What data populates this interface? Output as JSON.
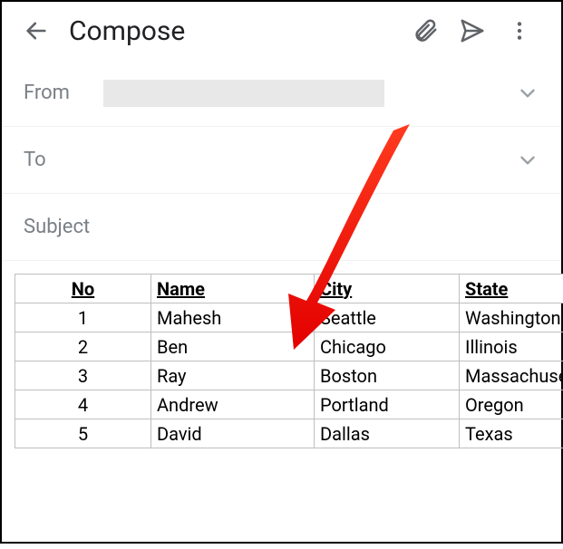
{
  "toolbar": {
    "title": "Compose"
  },
  "fields": {
    "from_label": "From",
    "to_label": "To",
    "subject_label": "Subject"
  },
  "table": {
    "headers": {
      "no": "No",
      "name": "Name",
      "city": "City",
      "state": "State"
    },
    "rows": [
      {
        "no": "1",
        "name": "Mahesh",
        "city": "Seattle",
        "state": "Washington"
      },
      {
        "no": "2",
        "name": "Ben",
        "city": "Chicago",
        "state": "Illinois"
      },
      {
        "no": "3",
        "name": "Ray",
        "city": "Boston",
        "state": "Massachusetts"
      },
      {
        "no": "4",
        "name": "Andrew",
        "city": "Portland",
        "state": "Oregon"
      },
      {
        "no": "5",
        "name": "David",
        "city": "Dallas",
        "state": "Texas"
      }
    ]
  }
}
